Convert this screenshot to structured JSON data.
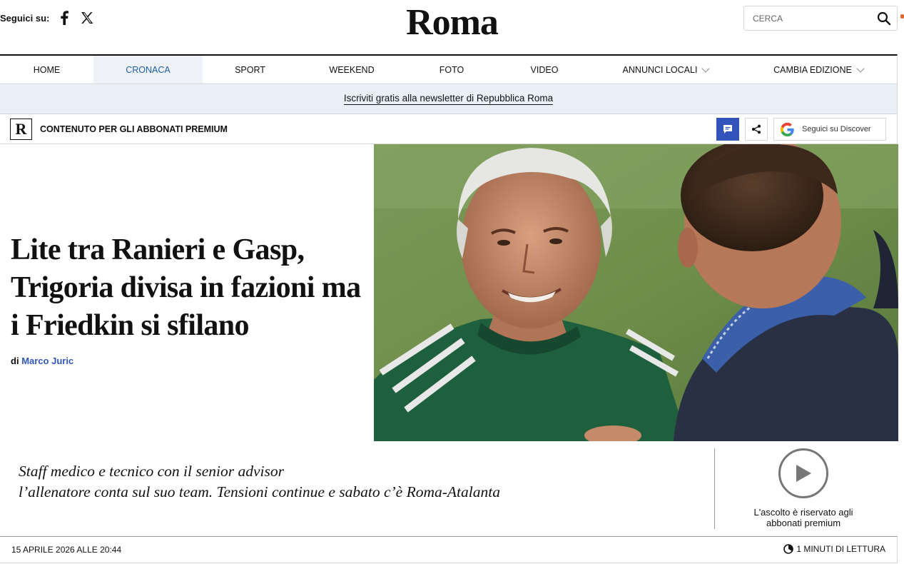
{
  "header": {
    "follow_label": "Seguici su:",
    "social": [
      {
        "icon": "facebook-icon"
      },
      {
        "icon": "x-icon"
      }
    ],
    "logo": "Roma",
    "search_placeholder": "CERCA"
  },
  "nav": {
    "items": [
      {
        "label": "HOME",
        "active": false
      },
      {
        "label": "CRONACA",
        "active": true
      },
      {
        "label": "SPORT",
        "active": false
      },
      {
        "label": "WEEKEND",
        "active": false
      },
      {
        "label": "FOTO",
        "active": false
      },
      {
        "label": "VIDEO",
        "active": false
      },
      {
        "label": "ANNUNCI LOCALI",
        "active": false,
        "dropdown": true
      },
      {
        "label": "CAMBIA EDIZIONE",
        "active": false,
        "dropdown": true
      }
    ]
  },
  "newsletter": {
    "label": "Iscriviti gratis alla newsletter di Repubblica Roma"
  },
  "premium": {
    "logo_letter": "R",
    "label": "CONTENUTO PER GLI ABBONATI PREMIUM",
    "discover_label": "Seguici su Discover"
  },
  "article": {
    "headline": "Lite tra Ranieri e Gasp, Trigoria divisa in fazioni ma i Friedkin si sfilano",
    "byline_prefix": "di",
    "author": "Marco Juric",
    "summary_line1": "Staff medico e tecnico con il senior advisor",
    "summary_line2": "l’allenatore conta sul suo team. Tensioni continue e sabato c’è Roma-Atalanta",
    "audio_notice_line1": "L'ascolto è riservato agli",
    "audio_notice_line2": "abbonati premium",
    "date": "15 APRILE 2026 ALLE 20:44",
    "reading_time": "1 MINUTI DI LETTURA"
  },
  "colors": {
    "accent": "#3355bb",
    "nav_active": "#1d5fa8",
    "newsletter_bg": "#e9f0f8"
  }
}
